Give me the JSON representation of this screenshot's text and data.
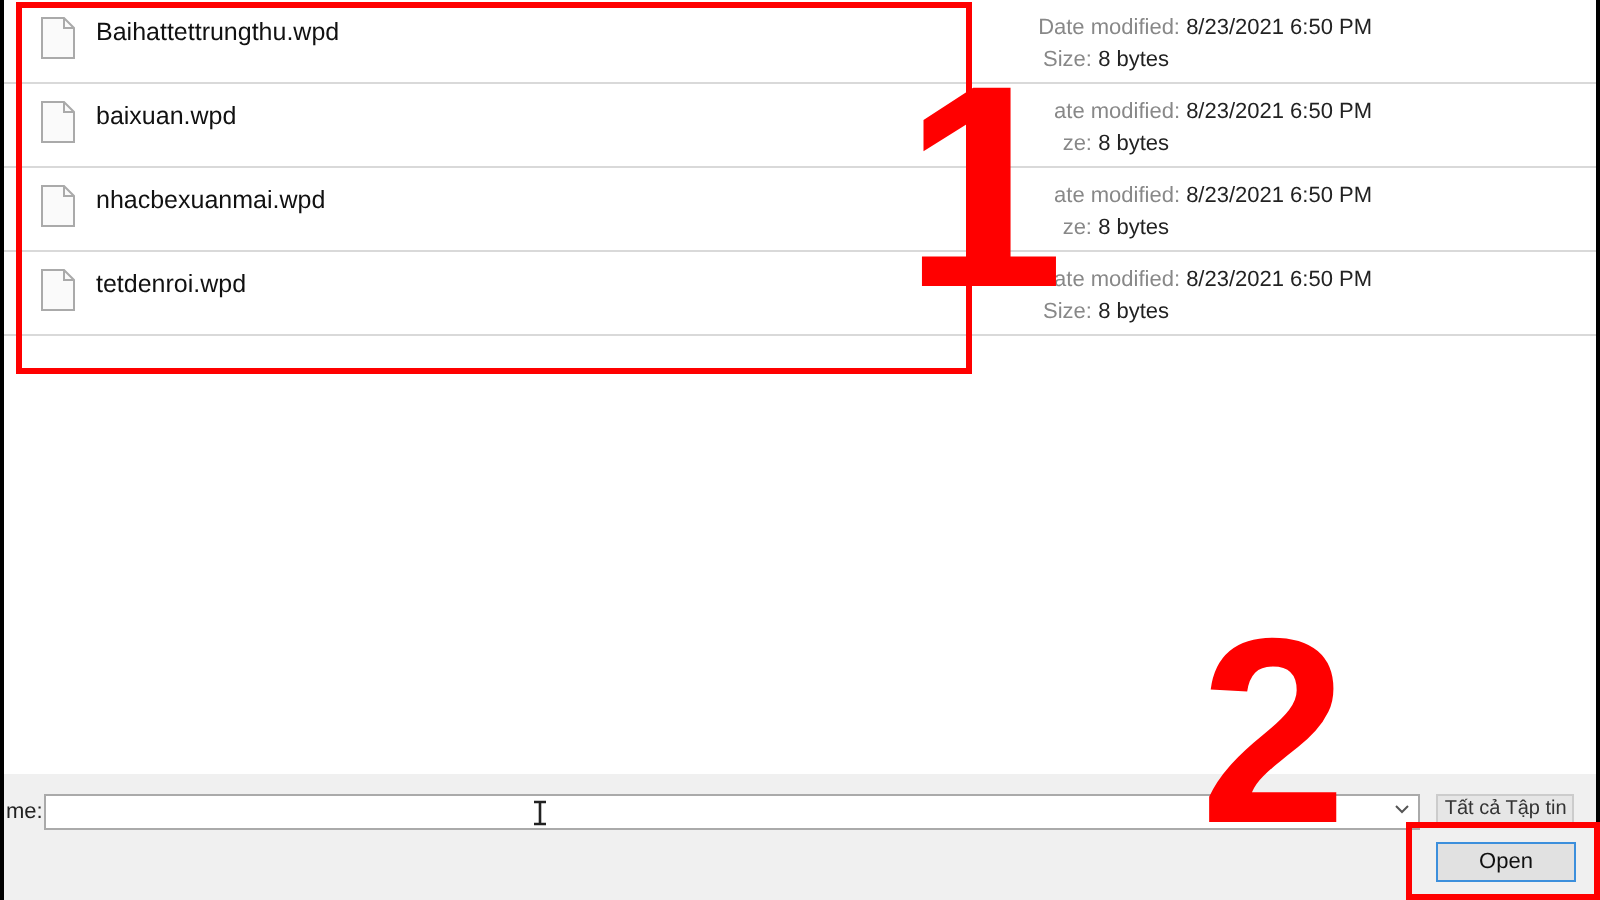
{
  "files": [
    {
      "name": "Baihattettrungthu.wpd",
      "date_label": "Date modified:",
      "date": "8/23/2021 6:50 PM",
      "size_label": "Size:",
      "size": "8 bytes"
    },
    {
      "name": "baixuan.wpd",
      "date_label": "ate modified:",
      "date": "8/23/2021 6:50 PM",
      "size_label": "ze:",
      "size": "8 bytes"
    },
    {
      "name": "nhacbexuanmai.wpd",
      "date_label": "ate modified:",
      "date": "8/23/2021 6:50 PM",
      "size_label": "ze:",
      "size": "8 bytes"
    },
    {
      "name": "tetdenroi.wpd",
      "date_label": "ate modified:",
      "date": "8/23/2021 6:50 PM",
      "size_label": "Size:",
      "size": "8 bytes"
    }
  ],
  "footer": {
    "file_name_label": "me:",
    "file_type": "Tất cả Tập tin",
    "open_button": "Open"
  },
  "annotations": [
    "1",
    "2"
  ]
}
